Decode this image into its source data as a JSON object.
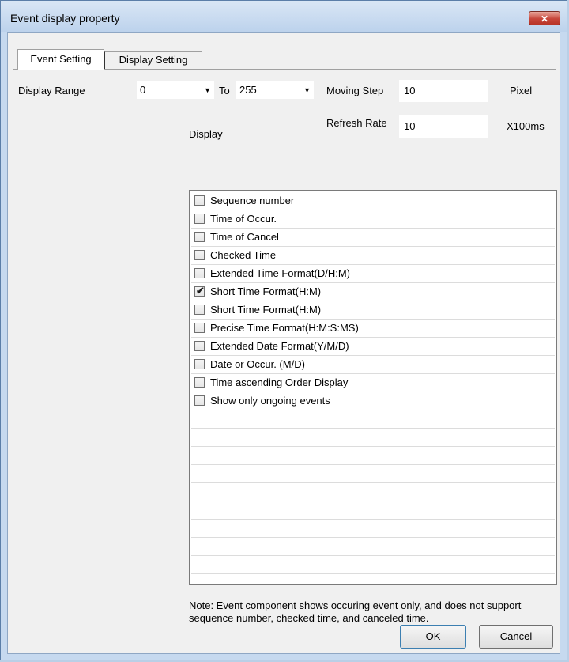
{
  "window": {
    "title": "Event display property",
    "close_label": "✕"
  },
  "tabs": [
    {
      "label": "Event Setting",
      "active": true
    },
    {
      "label": "Display Setting",
      "active": false
    }
  ],
  "form": {
    "display_range_label": "Display Range",
    "range_from": "0",
    "to_label": "To",
    "range_to": "255",
    "moving_step_label": "Moving Step",
    "moving_step_value": "10",
    "moving_step_unit": "Pixel",
    "display_label": "Display",
    "refresh_rate_label": "Refresh Rate",
    "refresh_rate_value": "10",
    "refresh_rate_unit": "X100ms"
  },
  "display_items": [
    {
      "label": "Sequence number",
      "checked": false
    },
    {
      "label": "Time of Occur.",
      "checked": false
    },
    {
      "label": "Time of Cancel",
      "checked": false
    },
    {
      "label": "Checked Time",
      "checked": false
    },
    {
      "label": "Extended Time Format(D/H:M)",
      "checked": false
    },
    {
      "label": "Short Time Format(H:M)",
      "checked": true
    },
    {
      "label": "Short Time Format(H:M)",
      "checked": false
    },
    {
      "label": "Precise Time Format(H:M:S:MS)",
      "checked": false
    },
    {
      "label": "Extended Date Format(Y/M/D)",
      "checked": false
    },
    {
      "label": "Date or Occur.  (M/D)",
      "checked": false
    },
    {
      "label": "Time ascending Order Display",
      "checked": false
    },
    {
      "label": "Show only ongoing events",
      "checked": false
    }
  ],
  "note": "Note: Event component shows occuring event only, and does not support sequence number, checked time, and canceled time.",
  "buttons": {
    "ok": "OK",
    "cancel": "Cancel"
  },
  "icons": {
    "dropdown": "dropdown-arrow-icon",
    "close": "close-icon",
    "checkbox": "checkbox-icon"
  }
}
